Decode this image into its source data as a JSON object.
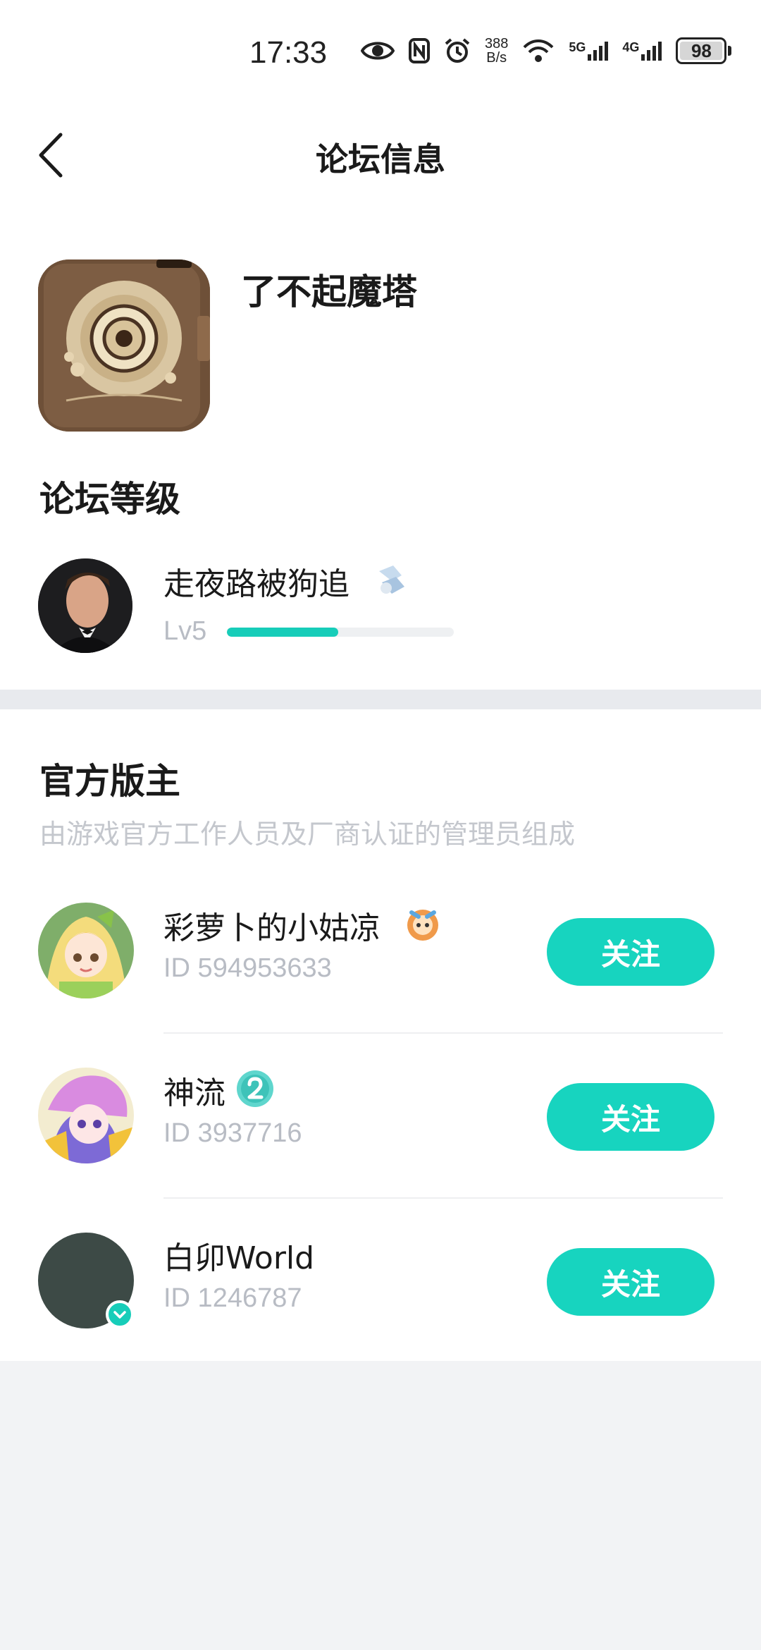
{
  "status_bar": {
    "time": "17:33",
    "speed_value": "388",
    "speed_unit": "B/s",
    "net_5g": "5G",
    "net_4g": "4G",
    "battery": "98",
    "icons": [
      "eye-icon",
      "nfc-icon",
      "alarm-icon",
      "wifi-icon",
      "signal-icon",
      "battery-icon"
    ]
  },
  "header": {
    "title": "论坛信息",
    "back_icon": "chevron-left-icon"
  },
  "forum": {
    "name": "了不起魔塔"
  },
  "level_section": {
    "title": "论坛等级",
    "user": {
      "name": "走夜路被狗追",
      "level": "Lv5",
      "progress": 0.49
    }
  },
  "moderators": {
    "title": "官方版主",
    "subtitle": "由游戏官方工作人员及厂商认证的管理员组成",
    "items": [
      {
        "name": "彩萝卜的小姑凉",
        "id": "ID 594953633",
        "button": "关注"
      },
      {
        "name": "神流",
        "id": "ID 3937716",
        "button": "关注"
      },
      {
        "name": "白卯World",
        "id": "ID 1246787",
        "button": "关注"
      }
    ]
  },
  "colors": {
    "accent": "#17d4bf",
    "muted_text": "#b8bcc4",
    "page_bg": "#f2f3f5"
  }
}
